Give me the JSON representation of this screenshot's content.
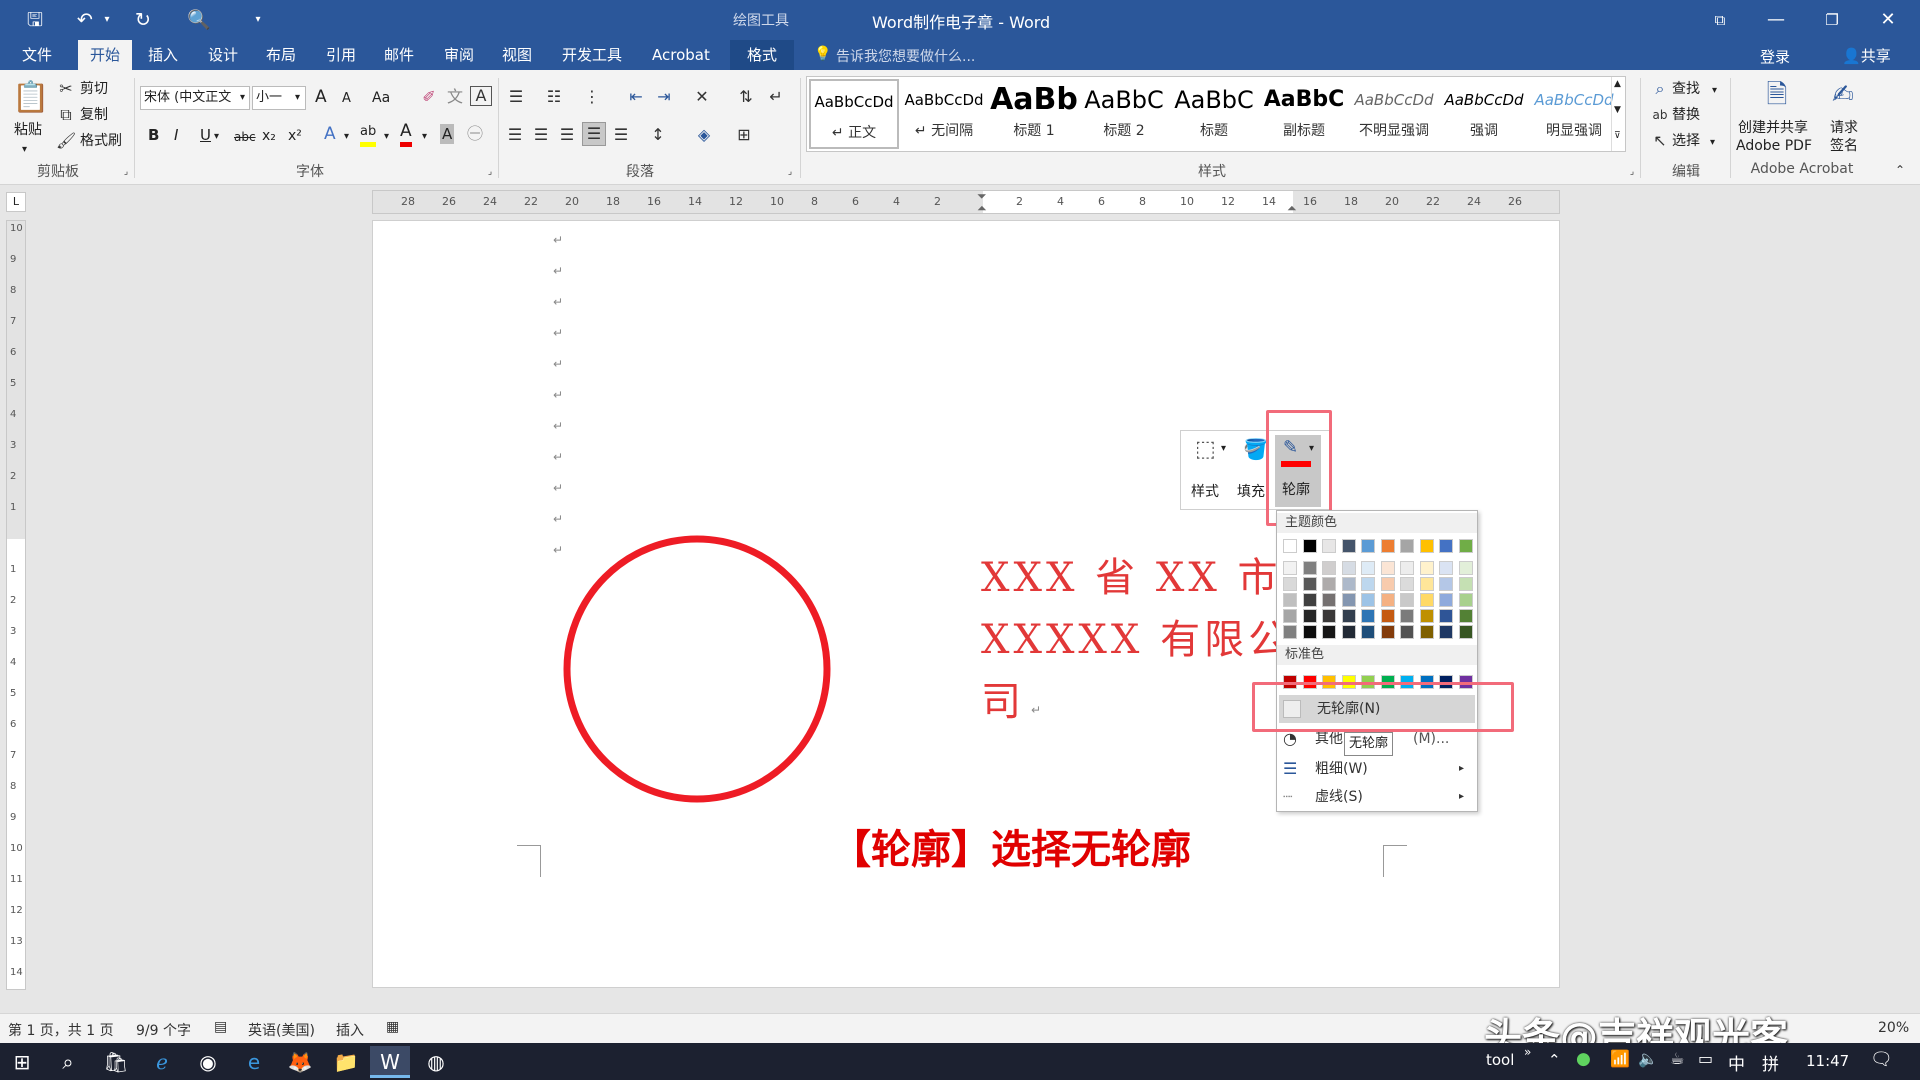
{
  "window": {
    "title": "Word制作电子章 - Word",
    "context_tool": "绘图工具"
  },
  "tabs": {
    "file": "文件",
    "home": "开始",
    "insert": "插入",
    "design": "设计",
    "layout": "布局",
    "references": "引用",
    "mailings": "邮件",
    "review": "审阅",
    "view": "视图",
    "developer": "开发工具",
    "acrobat": "Acrobat",
    "format": "格式",
    "tell_me": "告诉我您想要做什么...",
    "login": "登录",
    "share": "共享"
  },
  "clipboard": {
    "paste": "粘贴",
    "cut": "剪切",
    "copy": "复制",
    "format_painter": "格式刷",
    "label": "剪贴板"
  },
  "font": {
    "name": "宋体 (中文正文",
    "size": "小一",
    "grow": "A",
    "shrink": "A",
    "case": "Aa",
    "bold": "B",
    "italic": "I",
    "underline": "U",
    "strike": "abc",
    "subscript": "x₂",
    "superscript": "x²",
    "text_effect": "A",
    "highlight": "ab",
    "font_color": "A",
    "char_shading": "A",
    "label": "字体"
  },
  "paragraph": {
    "label": "段落"
  },
  "styles": {
    "items": [
      {
        "preview": "AaBbCcDd",
        "name": "↵ 正文"
      },
      {
        "preview": "AaBbCcDd",
        "name": "↵ 无间隔"
      },
      {
        "preview": "AaBb",
        "name": "标题 1"
      },
      {
        "preview": "AaBbC",
        "name": "标题 2"
      },
      {
        "preview": "AaBbC",
        "name": "标题"
      },
      {
        "preview": "AaBbC",
        "name": "副标题"
      },
      {
        "preview": "AaBbCcDd",
        "name": "不明显强调"
      },
      {
        "preview": "AaBbCcDd",
        "name": "强调"
      },
      {
        "preview": "AaBbCcDd",
        "name": "明显强调"
      }
    ],
    "label": "样式"
  },
  "editing": {
    "find": "查找",
    "replace": "替换",
    "select": "选择",
    "label": "编辑"
  },
  "acrobat_group": {
    "create_line1": "创建并共享",
    "create_line2": "Adobe PDF",
    "sign_line1": "请求",
    "sign_line2": "签名",
    "label": "Adobe Acrobat"
  },
  "ruler_h": {
    "left": [
      "28",
      "26",
      "24",
      "22",
      "20",
      "18",
      "16",
      "14",
      "12",
      "10",
      "8",
      "6",
      "4",
      "2"
    ],
    "right": [
      "2",
      "4",
      "6",
      "8",
      "10",
      "12",
      "14",
      "16",
      "18",
      "20",
      "22",
      "24",
      "26"
    ]
  },
  "ruler_v": {
    "top": [
      "10",
      "9",
      "8",
      "7",
      "6",
      "5",
      "4",
      "3",
      "2",
      "1"
    ],
    "bottom": [
      "1",
      "2",
      "3",
      "4",
      "5",
      "6",
      "7",
      "8",
      "9",
      "10",
      "11",
      "12",
      "13",
      "14"
    ]
  },
  "doc": {
    "line1": "XXX 省 XX 市",
    "line2": "XXXXX 有限公",
    "line3": "司",
    "caption": "【轮廓】选择无轮廓",
    "circle_color": "#ee1c25",
    "text_color": "#e23838"
  },
  "mini_toolbar": {
    "style": "样式",
    "fill": "填充",
    "outline": "轮廓"
  },
  "outline_menu": {
    "theme_colors_label": "主题颜色",
    "standard_colors_label": "标准色",
    "no_outline": "无轮廓(N)",
    "more_colors_prefix": "其他",
    "more_colors_suffix": "(M)...",
    "weight": "粗细(W)",
    "dashes": "虚线(S)",
    "tooltip": "无轮廓",
    "theme_top": [
      "#ffffff",
      "#000000",
      "#e7e6e6",
      "#44546a",
      "#5b9bd5",
      "#ed7d31",
      "#a5a5a5",
      "#ffc000",
      "#4472c4",
      "#70ad47"
    ],
    "theme_shades": [
      [
        "#f2f2f2",
        "#d9d9d9",
        "#bfbfbf",
        "#a6a6a6",
        "#808080"
      ],
      [
        "#808080",
        "#595959",
        "#404040",
        "#262626",
        "#0d0d0d"
      ],
      [
        "#d0cece",
        "#aeabab",
        "#757171",
        "#3a3838",
        "#171616"
      ],
      [
        "#d6dce4",
        "#adb9ca",
        "#8496b0",
        "#333f4f",
        "#222a35"
      ],
      [
        "#deebf6",
        "#bdd7ee",
        "#9dc3e6",
        "#2e75b5",
        "#1f4e79"
      ],
      [
        "#fbe5d5",
        "#f8cbad",
        "#f4b183",
        "#c55a11",
        "#833c0b"
      ],
      [
        "#ededed",
        "#dbdbdb",
        "#c9c9c9",
        "#7b7b7b",
        "#525252"
      ],
      [
        "#fff2cc",
        "#ffe699",
        "#ffd966",
        "#bf9000",
        "#7f6000"
      ],
      [
        "#dae3f3",
        "#b4c7e7",
        "#8faadc",
        "#2f5597",
        "#1f3864"
      ],
      [
        "#e2efd9",
        "#c5e0b3",
        "#a8d08d",
        "#538135",
        "#375623"
      ]
    ],
    "standard": [
      "#c00000",
      "#ff0000",
      "#ffc000",
      "#ffff00",
      "#92d050",
      "#00b050",
      "#00b0f0",
      "#0070c0",
      "#002060",
      "#7030a0"
    ]
  },
  "status": {
    "page": "第 1 页，共 1 页",
    "words": "9/9 个字",
    "language": "英语(美国)",
    "mode": "插入",
    "zoom": "20%",
    "watermark": "头条@吉祥观光客"
  },
  "taskbar": {
    "tool": "tool",
    "ime": "中",
    "ime2": "拼",
    "time": "11:47"
  }
}
